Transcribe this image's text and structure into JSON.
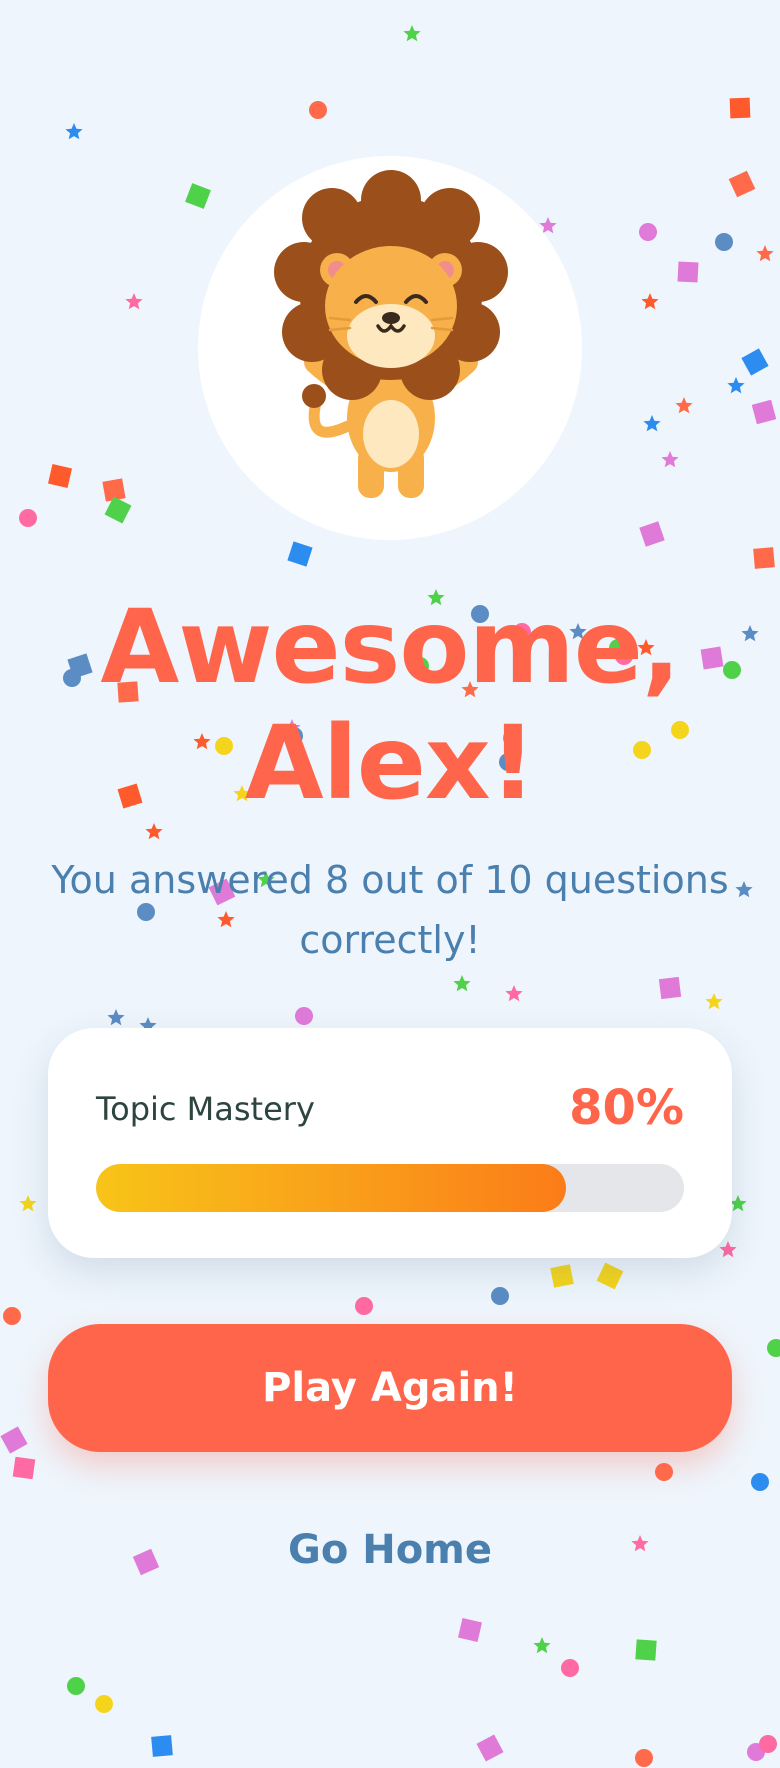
{
  "theme": {
    "background": "#eef5fc",
    "accent": "#ff654a",
    "secondary_text": "#4a7fae",
    "progress_gradient": [
      "#f8c418",
      "#fb7c18"
    ],
    "confetti_colors": [
      "#ff5a2c",
      "#4fd14a",
      "#2d8cf0",
      "#e07ad8",
      "#f4d51c",
      "#5b8cc4",
      "#ff6aa2",
      "#ff6b4a"
    ]
  },
  "mascot": {
    "icon": "lion-mascot-icon"
  },
  "result": {
    "headline": "Awesome, Alex!",
    "message": "You answered 8 out of 10 questions correctly!"
  },
  "mastery": {
    "label": "Topic Mastery",
    "percent_text": "80%",
    "progress": 0.8
  },
  "actions": {
    "play_again": "Play Again!",
    "go_home": "Go Home"
  }
}
